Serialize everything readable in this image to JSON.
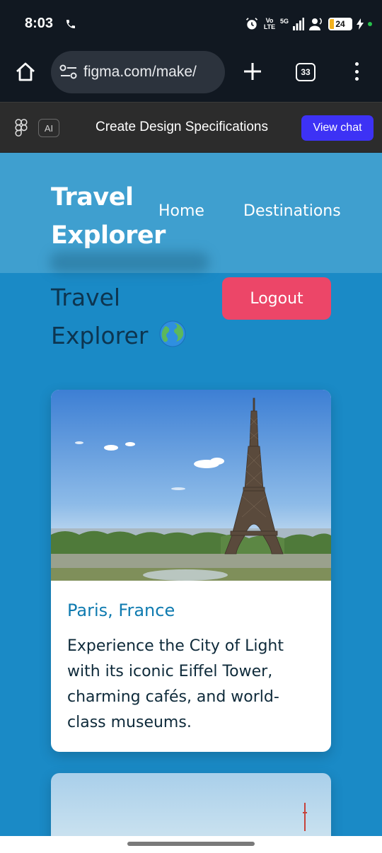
{
  "status_bar": {
    "time": "8:03",
    "network": "5G",
    "volte": "Vo LTE",
    "battery": "24"
  },
  "browser": {
    "url": "figma.com/make/",
    "tab_count": "33"
  },
  "figma_bar": {
    "ai_label": "AI",
    "title": "Create Design Specifications",
    "view_chat_label": "View chat"
  },
  "site": {
    "logo": "Travel Explorer",
    "nav": [
      {
        "label": "Home"
      },
      {
        "label": "Destinations"
      }
    ]
  },
  "main": {
    "title": "Travel Explorer",
    "logout_label": "Logout",
    "cards": [
      {
        "title": "Paris, France",
        "description": "Experience the City of Light with its iconic Eiffel Tower, charming cafés, and world-class museums."
      }
    ]
  },
  "colors": {
    "page_bg": "#1a8ac6",
    "header_bg": "#3f9fcf",
    "logout_bg": "#ec4668",
    "card_title": "#0f7bb0",
    "view_chat_bg": "#3d32f5"
  }
}
